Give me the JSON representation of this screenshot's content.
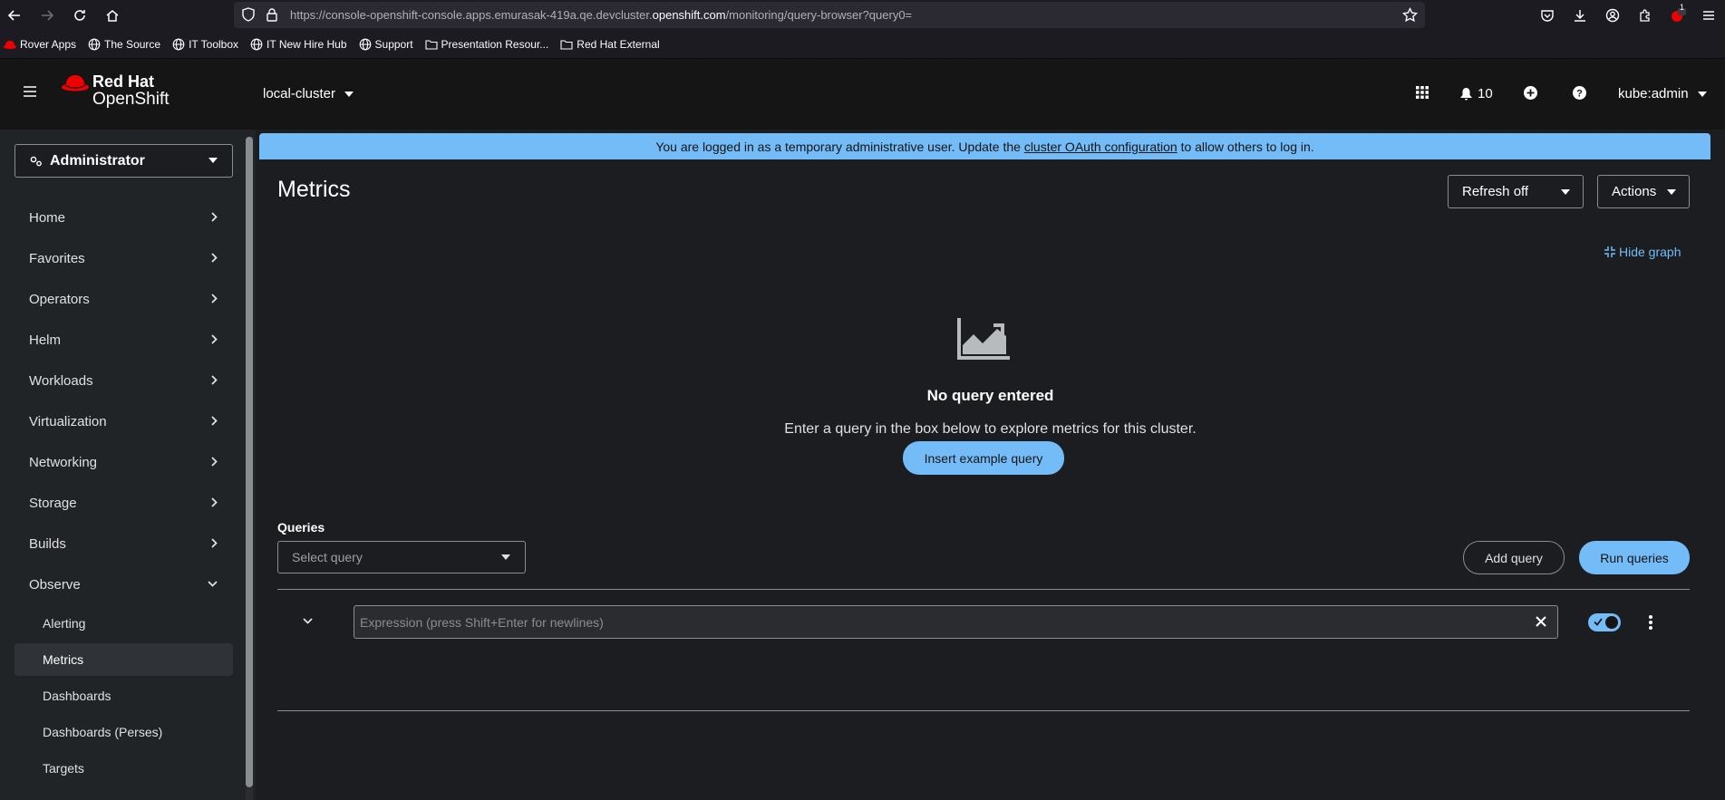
{
  "browser": {
    "url_prefix": "https://console-openshift-console.apps.emurasak-419a.qe.devcluster.",
    "url_domain": "openshift.com",
    "url_suffix": "/monitoring/query-browser?query0=",
    "ext_badge": "1",
    "bookmarks": [
      "Rover Apps",
      "The Source",
      "IT Toolbox",
      "IT New Hire Hub",
      "Support",
      "Presentation Resour...",
      "Red Hat External"
    ]
  },
  "masthead": {
    "brand_line1": "Red Hat",
    "brand_line2": "OpenShift",
    "cluster": "local-cluster",
    "notifications_count": "10",
    "user": "kube:admin"
  },
  "sidebar": {
    "perspective": "Administrator",
    "items": [
      "Home",
      "Favorites",
      "Operators",
      "Helm",
      "Workloads",
      "Virtualization",
      "Networking",
      "Storage",
      "Builds",
      "Observe"
    ],
    "observe_sub": [
      "Alerting",
      "Metrics",
      "Dashboards",
      "Dashboards (Perses)",
      "Targets"
    ]
  },
  "banner": {
    "text_before": "You are logged in as a temporary administrative user. Update the ",
    "link": "cluster OAuth configuration",
    "text_after": " to allow others to log in."
  },
  "page": {
    "title": "Metrics",
    "refresh": "Refresh off",
    "actions": "Actions",
    "hide_graph": "Hide graph",
    "empty_title": "No query entered",
    "empty_body": "Enter a query in the box below to explore metrics for this cluster.",
    "insert_example": "Insert example query",
    "queries_label": "Queries",
    "select_query_placeholder": "Select query",
    "add_query": "Add query",
    "run_queries": "Run queries",
    "expression_placeholder": "Expression (press Shift+Enter for newlines)"
  },
  "colors": {
    "accent": "#73bcf7",
    "masthead": "#151515",
    "sidebar": "#212427",
    "background": "#1b1d21"
  }
}
